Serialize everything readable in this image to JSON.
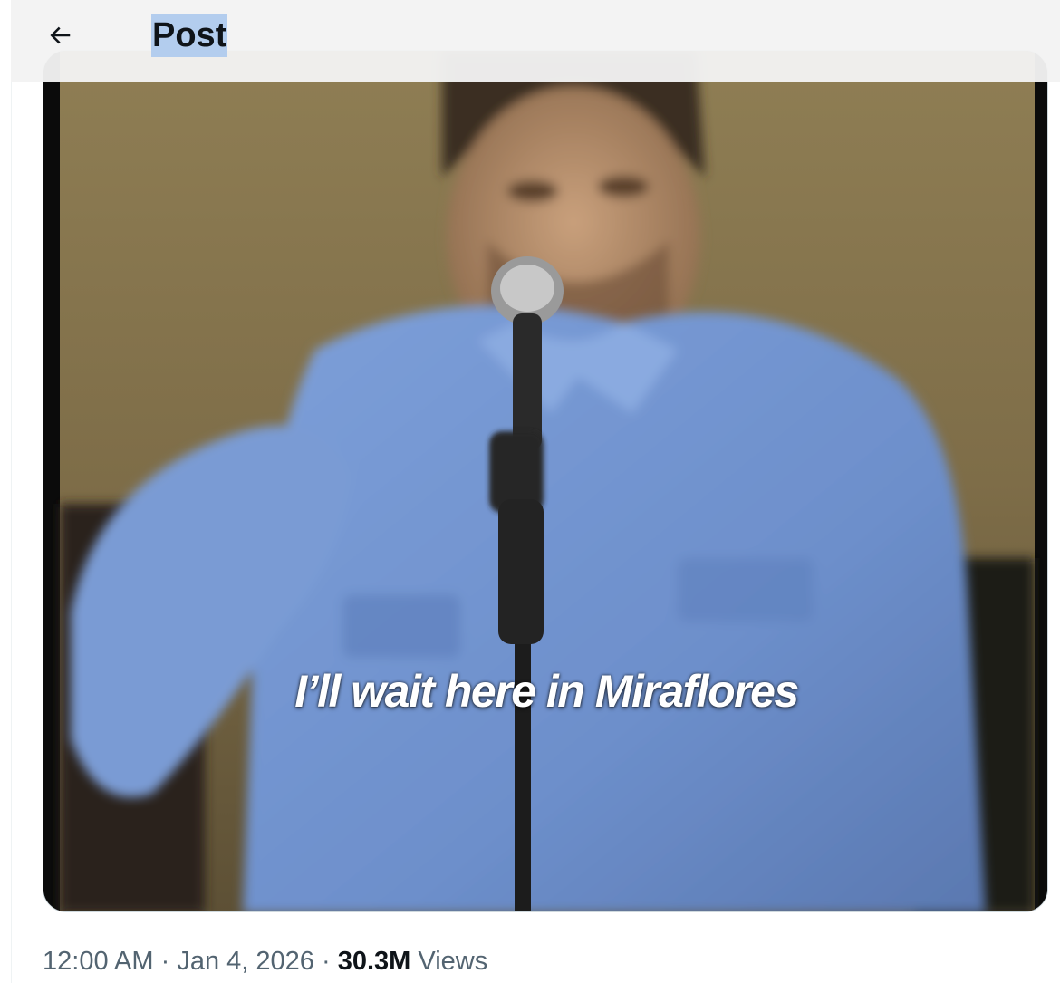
{
  "header": {
    "title": "Post",
    "back_icon": "arrow-left-icon"
  },
  "media": {
    "caption": "I’ll wait here in Miraflores"
  },
  "meta": {
    "time": "12:00 AM",
    "separator": "·",
    "date": "Jan 4, 2026",
    "views_count": "30.3M",
    "views_label": "Views"
  },
  "colors": {
    "text_primary": "#0f1419",
    "text_secondary": "#536471",
    "title_highlight": "#b3cdee",
    "shirt": "#6e93cf",
    "wall": "#7a6a45"
  }
}
